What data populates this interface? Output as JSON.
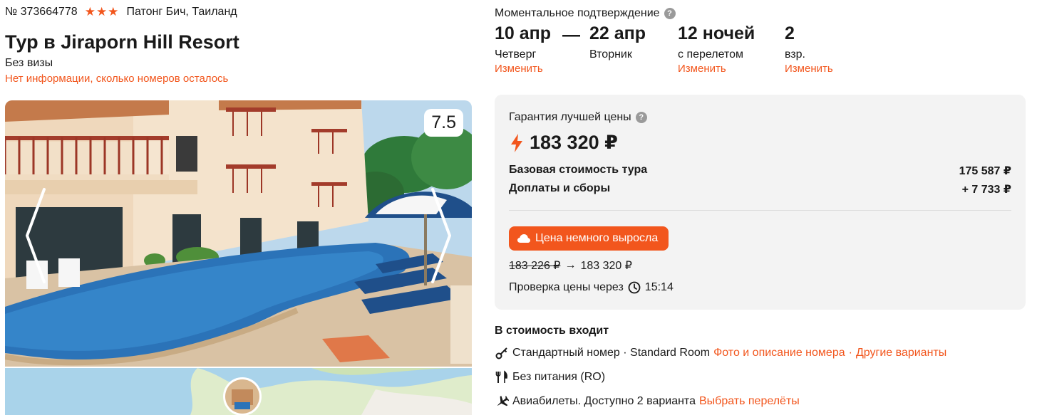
{
  "tour": {
    "number": "№ 373664778",
    "stars": "★★★",
    "location": "Патонг Бич, Таиланд",
    "title": "Тур в Jiraporn Hill Resort",
    "visa": "Без визы",
    "rooms_note": "Нет информации, сколько номеров осталось",
    "rating": "7.5"
  },
  "trip": {
    "confirmation": "Моментальное подтверждение",
    "date_from": "10 апр",
    "date_from_day": "Четверг",
    "dash": "—",
    "date_to": "22 апр",
    "date_to_day": "Вторник",
    "nights": "12 ночей",
    "nights_sub": "с перелетом",
    "adults": "2",
    "adults_sub": "взр.",
    "change_label": "Изменить"
  },
  "price": {
    "guarantee": "Гарантия лучшей цены",
    "total": "183 320 ₽",
    "base_label": "Базовая стоимость тура",
    "base_value": "175 587 ₽",
    "fees_label": "Доплаты и сборы",
    "fees_value": "+ 7 733 ₽",
    "badge": "Цена немного выросла",
    "old_price": "183 226 ₽",
    "arrow": "→",
    "new_price": "183 320 ₽",
    "check_label": "Проверка цены через",
    "check_time": "15:14"
  },
  "included": {
    "title": "В стоимость входит",
    "room": "Стандартный номер · Standard Room",
    "room_link_photo": "Фото и описание номера",
    "room_link_other": "Другие варианты",
    "dot": "·",
    "meal": "Без питания (RO)",
    "flights": "Авиабилеты. Доступно 2 варианта",
    "flights_link": "Выбрать перелёты"
  },
  "colors": {
    "accent": "#f2561d",
    "panel_bg": "#f3f3f3"
  }
}
